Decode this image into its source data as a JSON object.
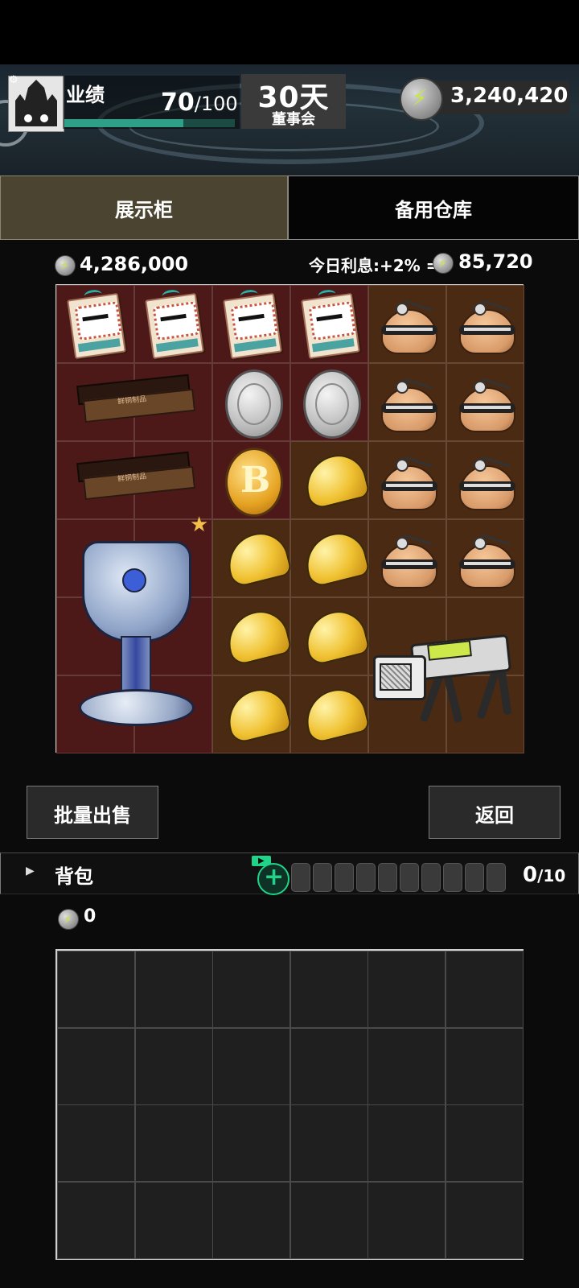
{
  "header": {
    "performance_label": "业绩",
    "performance_current": "70",
    "performance_max": "/100",
    "performance_fraction": 0.7,
    "days_value": "30天",
    "days_label": "董事会",
    "coin_total": "3,240,420"
  },
  "tabs": [
    {
      "label": "展示柜",
      "active": true
    },
    {
      "label": "备用仓库",
      "active": false
    }
  ],
  "display": {
    "coin_total": "4,286,000",
    "interest_label": "今日利息:+2% =",
    "interest_value": "85,720"
  },
  "items": {
    "card_caption": "CONGRATULATIONS",
    "bar_text": "鲜铜制品"
  },
  "buttons": {
    "bulk_sell": "批量出售",
    "back": "返回"
  },
  "backpack": {
    "label": "背包",
    "count": "0",
    "max": "/10",
    "coin_total": "0"
  },
  "colors": {
    "accent_green": "#1fd488",
    "progress_green": "#2fa088",
    "tab_active_bg": "#4a4430",
    "cell_red": "#4d1818",
    "cell_brown": "#4a2a12"
  }
}
